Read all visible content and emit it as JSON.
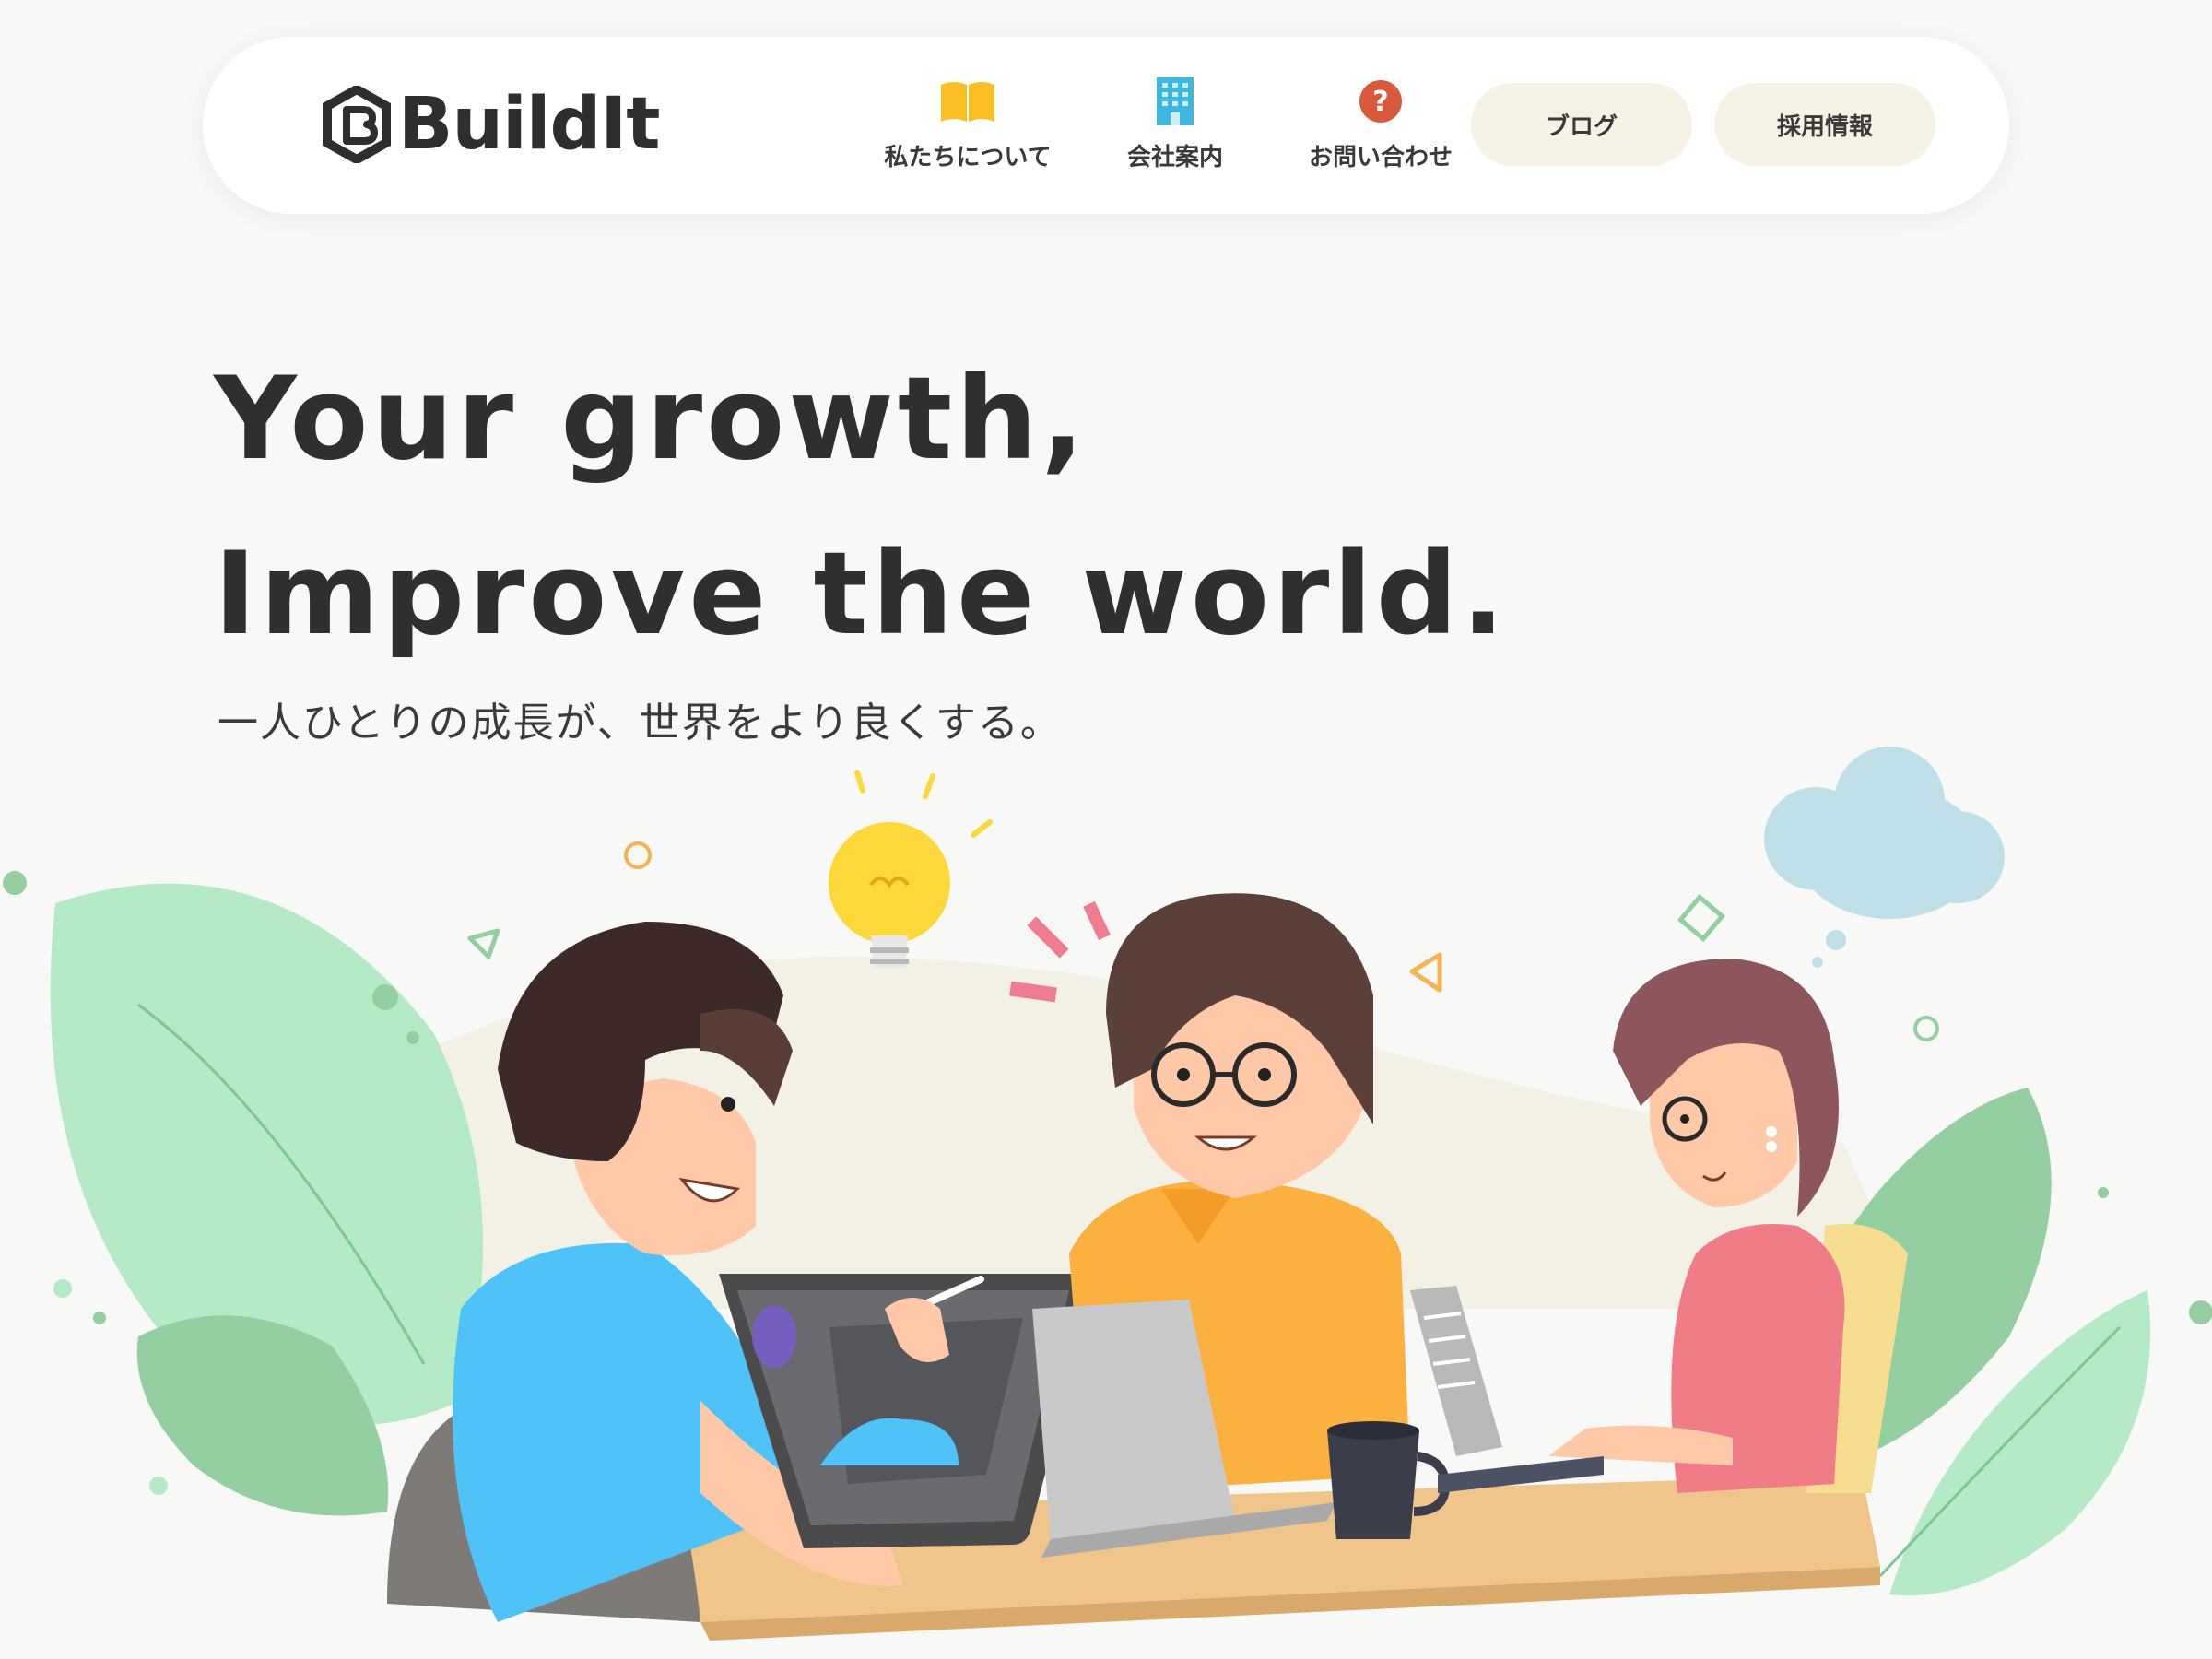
{
  "brand": {
    "name": "BuildIt",
    "logo_icon": "hexagon-b-icon",
    "text_color": "#2e2e2e"
  },
  "nav": {
    "items": [
      {
        "label": "私たちについて",
        "icon": "book-icon",
        "icon_color": "#fbbf24"
      },
      {
        "label": "会社案内",
        "icon": "building-icon",
        "icon_color": "#3fb8e0"
      },
      {
        "label": "お問い合わせ",
        "icon": "question-circle-icon",
        "icon_color": "#d95a3a"
      }
    ],
    "buttons": [
      {
        "label": "ブログ"
      },
      {
        "label": "採用情報"
      }
    ],
    "pill_color": "#f6f2e6"
  },
  "hero": {
    "title_line1": "Your growth,",
    "title_line2": "Improve the world.",
    "subtitle": "一人ひとりの成長が、世界をより良くする。"
  },
  "illustration": {
    "description_icons": [
      "lightbulb-icon",
      "thought-cloud-icon",
      "leaf-icon",
      "tablet-icon",
      "laptop-icon",
      "mug-icon"
    ],
    "colors": {
      "leaf_light": "#b4ebc6",
      "leaf_dark": "#93cfa1",
      "shirt_blue": "#4fc3f7",
      "shirt_orange": "#fbb040",
      "shirt_pink": "#f07c88",
      "desk": "#efc58b",
      "bulb": "#fdd83a",
      "cloud": "#bfe0e8"
    }
  }
}
